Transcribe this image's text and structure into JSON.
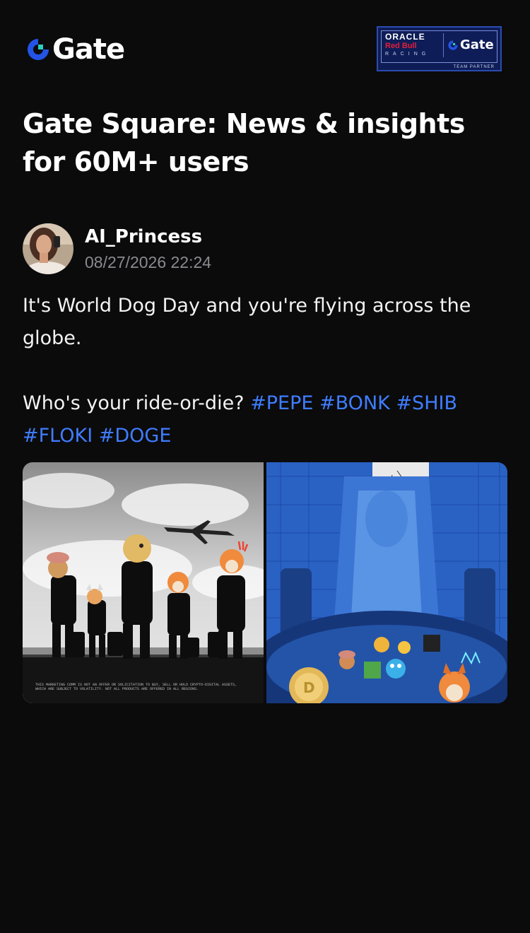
{
  "brand": {
    "name": "Gate",
    "accent": "#2354e6",
    "accent_light": "#2ad0c0"
  },
  "partner": {
    "line1": "ORACLE",
    "line2": "Red Bull",
    "line3": "RACING",
    "gate": "Gate",
    "tagline": "TEAM PARTNER"
  },
  "headline": "Gate Square: News & insights for 60M+ users",
  "post": {
    "author": "AI_Princess",
    "timestamp": "08/27/2026 22:24",
    "line1": "It's World Dog Day and you're flying across the globe.",
    "question": "Who's your ride-or-die?",
    "hashtags": [
      "#PEPE",
      "#BONK",
      "#SHIB",
      "#FLOKI",
      "#DOGE"
    ],
    "images": [
      {
        "name": "airport-dogs",
        "disclaimer": "THIS MARKETING COMM IS NOT AN OFFER OR SOLICITATION TO BUY, SELL OR HOLD CRYPTO-DIGITAL ASSETS, WHICH ARE SUBJECT TO VOLATILITY. NOT ALL PRODUCTS ARE OFFERED IN ALL REGIONS."
      },
      {
        "name": "throne-room-memecoins"
      }
    ]
  },
  "icons": {
    "logo": "gate-logo-icon",
    "avatar": "avatar"
  }
}
